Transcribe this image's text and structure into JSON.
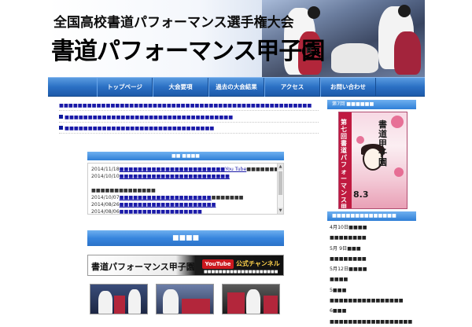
{
  "header": {
    "subtitle": "全国高校書道パフォーマンス選手権大会",
    "title": "書道パフォーマンス甲子園",
    "registered_mark": "R"
  },
  "nav": {
    "items": [
      {
        "label": "トップページ"
      },
      {
        "label": "大会要項"
      },
      {
        "label": "過去の大会結果"
      },
      {
        "label": "アクセス"
      },
      {
        "label": "お問い合わせ"
      }
    ]
  },
  "main": {
    "notices": [
      {
        "text": "■■■■■■■■■■■■■■■■■■■■■■■■■■■■■■■■■■■■■■■■■■■■■■■■■■■■■■",
        "bullet": false
      },
      {
        "text": "■■■■■■■■■■■■■■■■■■■■■■■■■■■■■■■■■■■■",
        "bullet": true
      },
      {
        "text": "■■■■■■■■■■■■■■■■■■■■■■■■■■■■■■■■",
        "bullet": true
      }
    ],
    "news": {
      "header": "■■ ■■■■",
      "lines": [
        {
          "date": "2014/11/18",
          "link": "■■■■■■■■■■■■■■■■■■■■■■■You Tube",
          "suffix": "■■■■■■■■"
        },
        {
          "date": "2014/10/10",
          "link": "■■■■■■■■■■■■■■■■■■■■■■■■",
          "suffix": ""
        },
        {
          "date": "",
          "link": "",
          "suffix": ""
        },
        {
          "date": "",
          "link": "",
          "suffix": "■■■■■■■■■■■■■■"
        },
        {
          "date": "2014/10/07",
          "link": "■■■■■■■■■■■■■■■■■■■■",
          "suffix": "■■■■■■■"
        },
        {
          "date": "2014/08/26",
          "link": "■■■■■■■■■■■■■■■■■■■■■",
          "suffix": ""
        },
        {
          "date": "2014/08/06",
          "link": "■■■■■■■■■■■■■■■■■■",
          "suffix": ""
        }
      ]
    },
    "video": {
      "header": "■■■■",
      "banner_title": "書道パフォーマンス甲子園",
      "youtube_logo": "YouTube",
      "channel_label": "公式チャンネル",
      "banner_sub": "■■■■■■■■■■■■■■■■■■■■"
    }
  },
  "sidebar": {
    "poster_head": "第7回 ■■■■■■",
    "poster": {
      "vertical_text": "第七回書道パフォーマンス甲子園",
      "title": "書道甲子園",
      "date": "8.3"
    },
    "list_head": "■■■■■■■■■■■■■■",
    "list_items": [
      {
        "label": "4月10日■■■■"
      },
      {
        "label": "■■■■■■■■"
      },
      {
        "label": "5月 9日■■■"
      },
      {
        "label": "■■■■■■■■"
      },
      {
        "label": "5月12日■■■■"
      },
      {
        "label": "■■■■"
      },
      {
        "label": "5■■■"
      },
      {
        "label": "■■■■■■■■■■■■■■■■"
      },
      {
        "label": "6■■■"
      },
      {
        "label": "■■■■■■■■■■■■■■■■■■"
      }
    ]
  },
  "colors": {
    "nav_blue": "#2b70c4",
    "section_head_blue": "#3785dd",
    "link_blue": "#1a1aa8",
    "accent_red": "#b3263b"
  }
}
